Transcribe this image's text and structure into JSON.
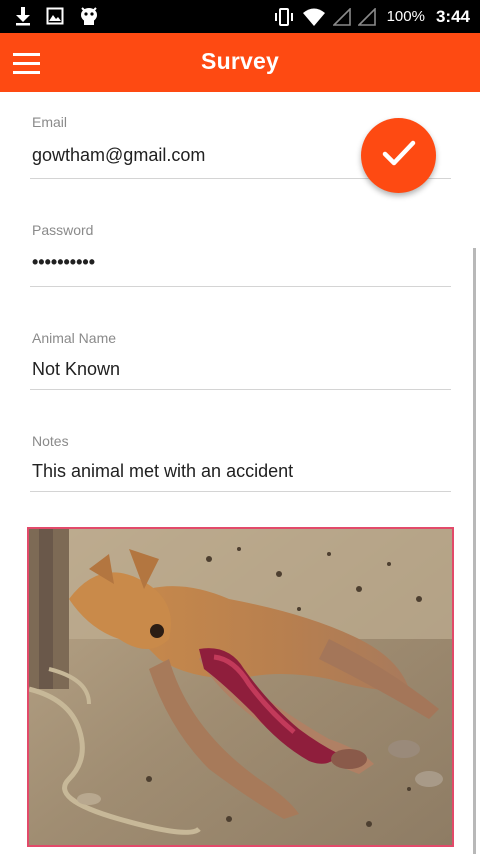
{
  "status_bar": {
    "icons_left": [
      "download-icon",
      "image-icon",
      "android-debug-icon"
    ],
    "icons_right": [
      "vibrate-icon",
      "wifi-icon",
      "signal-icon",
      "signal-icon",
      "battery-icon"
    ],
    "battery": "100%",
    "time": "3:44",
    "background": "#000000"
  },
  "app_bar": {
    "title": "Survey",
    "menu_icon": "hamburger-menu-icon",
    "color": "#fe4a12"
  },
  "fab": {
    "icon": "check-icon",
    "color": "#fe4a12"
  },
  "form": {
    "email": {
      "label": "Email",
      "value": "gowtham@gmail.com"
    },
    "password": {
      "label": "Password",
      "value": "••••••••••"
    },
    "animal_name": {
      "label": "Animal Name",
      "value": "Not Known"
    },
    "notes": {
      "label": "Notes",
      "value": "This animal met with an accident"
    }
  },
  "photo": {
    "subject": "injured-dog-photo",
    "border_color": "#e24a6a"
  }
}
